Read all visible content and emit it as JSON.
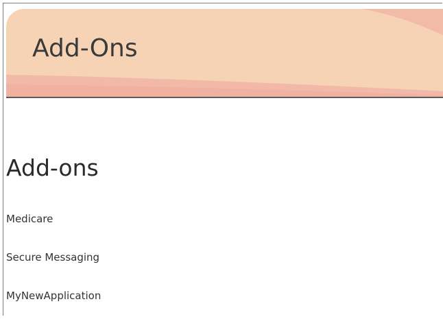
{
  "banner": {
    "title": "Add-Ons",
    "colors": {
      "base": "#f6d3b5",
      "accent": "#f0b6a4",
      "highlight": "#f3b3a0"
    }
  },
  "main": {
    "heading": "Add-ons",
    "addons": [
      {
        "label": "Medicare"
      },
      {
        "label": "Secure Messaging"
      },
      {
        "label": "MyNewApplication"
      }
    ]
  }
}
